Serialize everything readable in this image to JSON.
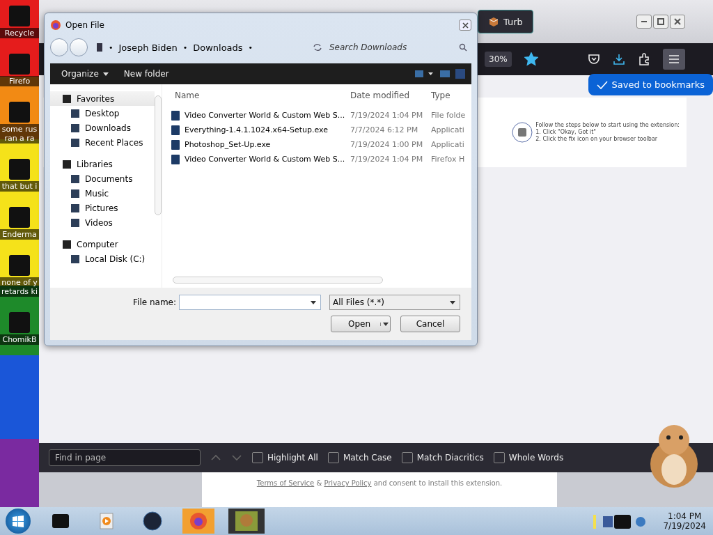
{
  "desktop": {
    "icons": [
      {
        "label": "Recycle"
      },
      {
        "label": "Firefo"
      },
      {
        "label": "some rus ran a ra"
      },
      {
        "label": "that but i"
      },
      {
        "label": "Enderma"
      },
      {
        "label": "none of y retards ki"
      },
      {
        "label": "ChomikB"
      }
    ]
  },
  "browser": {
    "tab": {
      "label": "Turb"
    },
    "zoom": "30%",
    "bookmarked": true,
    "notice": "Saved to bookmarks",
    "page": {
      "steps": [
        "Follow the steps below to start using the extension:",
        "1. Click \"Okay, Got it\"",
        "2. Click the fix icon on your browser toolbar"
      ],
      "consent": {
        "links": [
          "Terms of Service",
          "Privacy Policy"
        ],
        "joiner": "&",
        "rest": "and consent to install this extension."
      }
    },
    "find_bar": {
      "placeholder": "Find in page",
      "options": [
        {
          "label": "Highlight All",
          "checked": false
        },
        {
          "label": "Match Case",
          "checked": false
        },
        {
          "label": "Match Diacritics",
          "checked": false
        },
        {
          "label": "Whole Words",
          "checked": false
        }
      ]
    }
  },
  "dialog": {
    "title": "Open File",
    "breadcrumb": [
      "Joseph Biden",
      "Downloads"
    ],
    "breadcrumb_separator": "•",
    "search": {
      "placeholder": "Search Downloads"
    },
    "toolbar": [
      {
        "label": "Organize",
        "menu": true
      },
      {
        "label": "New folder",
        "menu": false
      }
    ],
    "nav": [
      {
        "label": "Favorites",
        "selected": true,
        "children": [
          {
            "label": "Desktop"
          },
          {
            "label": "Downloads"
          },
          {
            "label": "Recent Places"
          }
        ]
      },
      {
        "label": "Libraries",
        "selected": false,
        "children": [
          {
            "label": "Documents"
          },
          {
            "label": "Music"
          },
          {
            "label": "Pictures"
          },
          {
            "label": "Videos"
          }
        ]
      },
      {
        "label": "Computer",
        "selected": false,
        "children": [
          {
            "label": "Local Disk (C:)"
          }
        ]
      }
    ],
    "columns": [
      "Name",
      "Date modified",
      "Type"
    ],
    "files": [
      {
        "name": "Video Converter World & Custom Web S...",
        "date": "7/19/2024 1:04 PM",
        "type": "File folde"
      },
      {
        "name": "Everything-1.4.1.1024.x64-Setup.exe",
        "date": "7/7/2024 6:12 PM",
        "type": "Applicati"
      },
      {
        "name": "Photoshop_Set-Up.exe",
        "date": "7/19/2024 1:00 PM",
        "type": "Applicati"
      },
      {
        "name": "Video Converter World & Custom Web S...",
        "date": "7/19/2024 1:04 PM",
        "type": "Firefox H"
      }
    ],
    "file_name": {
      "label": "File name:"
    },
    "filter": "All Files (*.*)",
    "buttons": [
      {
        "label": "Open",
        "kind": "split"
      },
      {
        "label": "Cancel",
        "kind": "plain"
      }
    ]
  },
  "taskbar": {
    "time": "1:04 PM",
    "date": "7/19/2024"
  }
}
